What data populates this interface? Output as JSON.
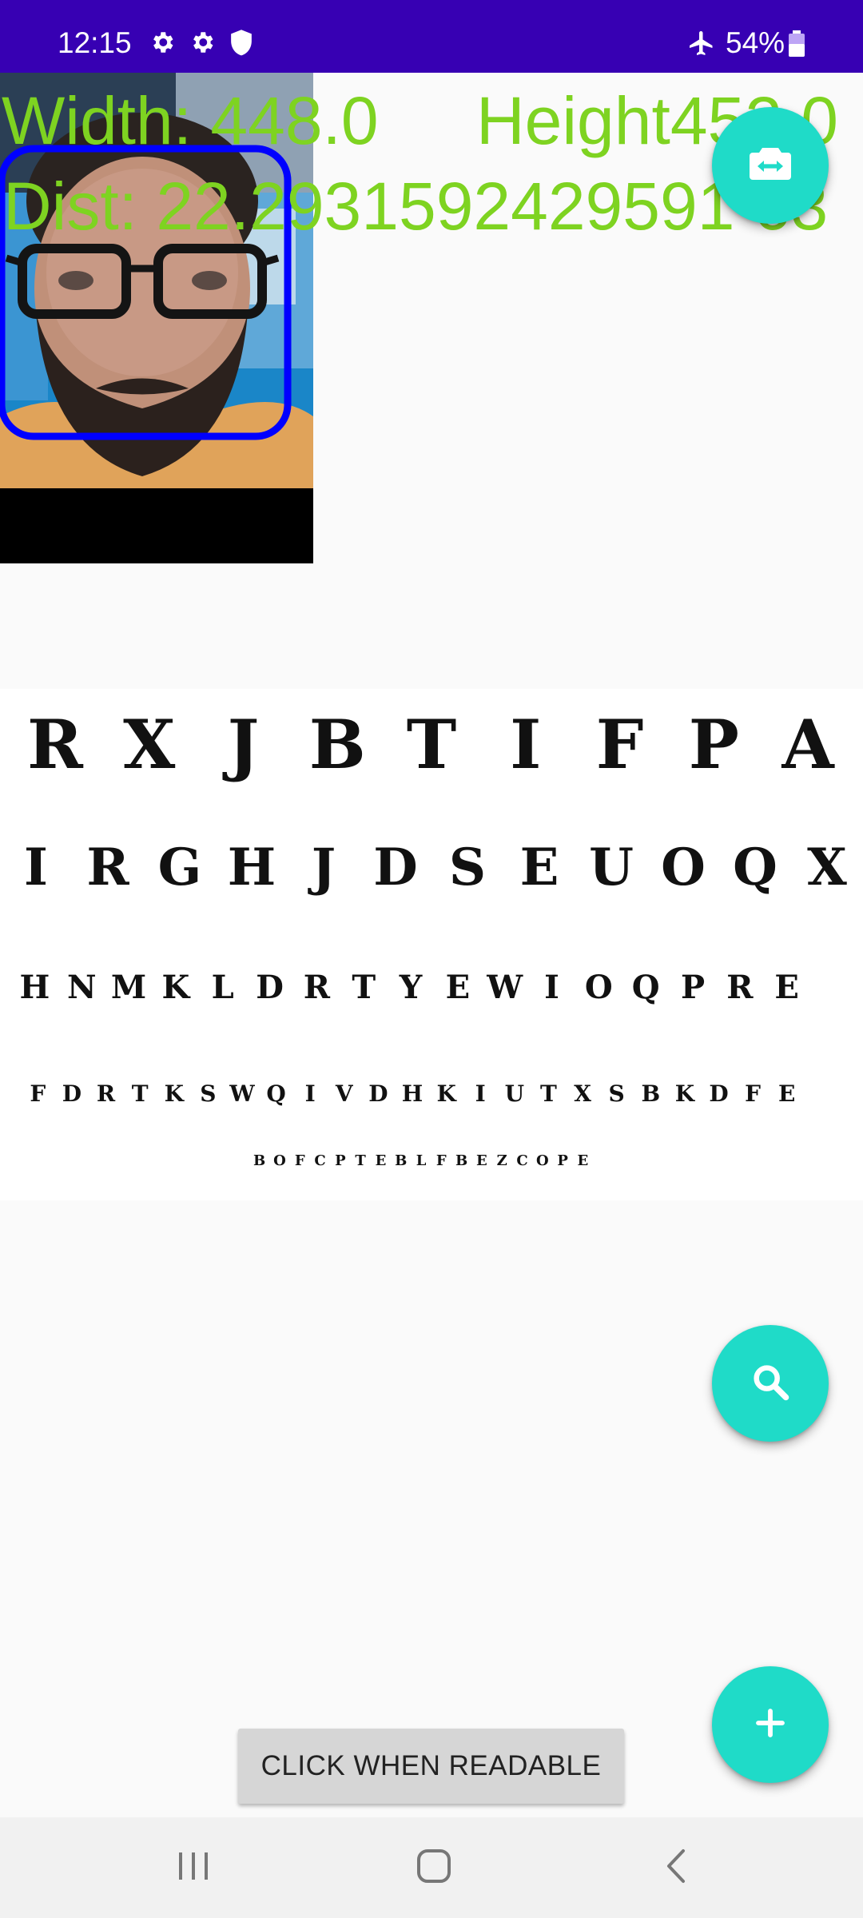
{
  "status_bar": {
    "time": "12:15",
    "battery_percent": "54%",
    "icons": [
      "settings-icon",
      "settings-icon",
      "shield-icon",
      "airplane-icon",
      "battery-icon"
    ],
    "background": "#3700b3"
  },
  "camera": {
    "width_label": "Width: 448.0",
    "height_label": "Height452.0",
    "distance_label": "Dist: 22.2931592429591 63",
    "overlay_color": "#7ed321",
    "face_box_color": "#0000ff"
  },
  "eye_chart": {
    "rows": [
      [
        "R",
        "X",
        "J",
        "B",
        "T",
        "I",
        "F",
        "P",
        "A"
      ],
      [
        "I",
        "R",
        "G",
        "H",
        "J",
        "D",
        "S",
        "E",
        "U",
        "O",
        "Q",
        "X"
      ],
      [
        "H",
        "N",
        "M",
        "K",
        "L",
        "D",
        "R",
        "T",
        "Y",
        "E",
        "W",
        "I",
        "O",
        "Q",
        "P",
        "R",
        "E"
      ],
      [
        "F",
        "D",
        "R",
        "T",
        "K",
        "S",
        "W",
        "Q",
        "I",
        "V",
        "D",
        "H",
        "K",
        "I",
        "U",
        "T",
        "X",
        "S",
        "B",
        "K",
        "D",
        "F",
        "E"
      ],
      [
        "B",
        "O",
        "F",
        "C",
        "P",
        "T",
        "E",
        "B",
        "L",
        "F",
        "B",
        "E",
        "Z",
        "C",
        "O",
        "P",
        "E"
      ]
    ]
  },
  "actions": {
    "readable_button_label": "CLICK WHEN READABLE",
    "switch_camera_icon": "switch-camera-icon",
    "search_icon": "search-icon",
    "add_icon": "add-icon",
    "fab_color": "#1fdbc8"
  },
  "nav_bar": {
    "icons": [
      "recent-apps-icon",
      "home-icon",
      "back-icon"
    ]
  }
}
